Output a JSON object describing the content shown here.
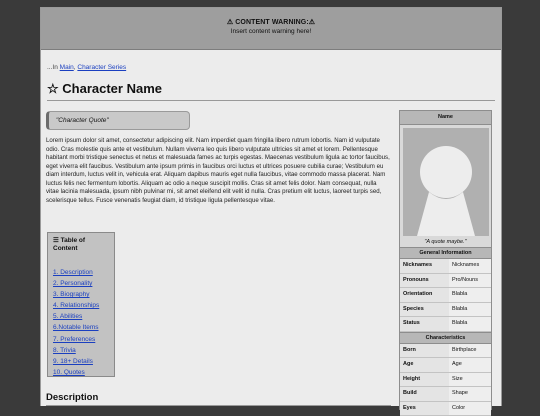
{
  "warning": {
    "title": "⚠ CONTENT WARNING:⚠",
    "text": "Insert content warning here!"
  },
  "breadcrumb": {
    "prefix": "...In ",
    "links": [
      "Main",
      "Character Series"
    ],
    "separator": ", "
  },
  "page_title": "☆ Character Name",
  "quote": "\"Character Quote\"",
  "body_text": "Lorem ipsum dolor sit amet, consectetur adipiscing elit. Nam imperdiet quam fringilla libero rutrum lobortis. Nam id vulputate odio. Cras molestie quis ante et vestibulum. Nullam viverra leo quis libero vulputate ultricies sit amet et lorem. Pellentesque habitant morbi tristique senectus et netus et malesuada fames ac turpis egestas. Maecenas vestibulum ligula ac tortor faucibus, eget viverra elit faucibus. Vestibulum ante ipsum primis in faucibus orci luctus et ultrices posuere cubilia curae; Vestibulum eu diam interdum, luctus velit in, vehicula erat. Aliquam dapibus mauris eget nulla faucibus, vitae commodo massa placerat. Nam luctus felis nec fermentum lobortis. Aliquam ac odio a neque suscipit mollis. Cras sit amet felis dolor. Nam consequat, nulla vitae lacinia malesuada, ipsum nibh pulvinar mi, sit amet eleifend elit velit id nulla. Cras pretium elit luctus, laoreet turpis sed, scelerisque tellus. Fusce venenatis feugiat diam, id tristique ligula pellentesque vitae.",
  "toc": {
    "heading": "☰ Table of Content",
    "items": [
      "1. Description",
      "2. Personality",
      "3. Biography",
      "4. Relationships",
      "5. Abilities",
      "6.Notable Items",
      "7. Preferences",
      "8. Trivia",
      "9. 18+ Details",
      "10. Quotes"
    ]
  },
  "section_heading": "Description",
  "infobox": {
    "name": "Name",
    "caption": "\"A quote maybe.\"",
    "general_heading": "General Information",
    "general": [
      {
        "k": "Nicknames",
        "v": "Nicknames"
      },
      {
        "k": "Pronouns",
        "v": "Pro/Nouns"
      },
      {
        "k": "Orientation",
        "v": "Blabla"
      },
      {
        "k": "Species",
        "v": "Blabla"
      },
      {
        "k": "Status",
        "v": "Blabla"
      }
    ],
    "char_heading": "Characteristics",
    "characteristics": [
      {
        "k": "Born",
        "v": "Birthplace"
      },
      {
        "k": "Age",
        "v": "Age"
      },
      {
        "k": "Height",
        "v": "Size"
      },
      {
        "k": "Build",
        "v": "Shape"
      },
      {
        "k": "Eyes",
        "v": "Color"
      }
    ]
  },
  "colors": {
    "link": "#1a3fc0",
    "outer_background": "#3a3a3a",
    "page_background": "#ececec",
    "warning_background": "#9e9e9e"
  }
}
